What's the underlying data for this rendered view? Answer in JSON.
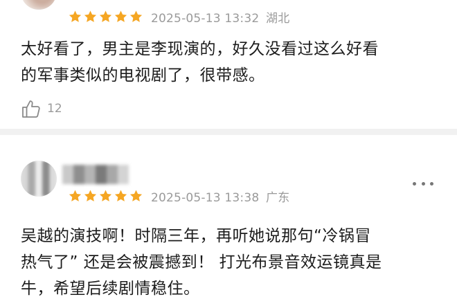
{
  "reviews": [
    {
      "rating": 5,
      "date": "2025-05-13 13:32",
      "region": "湖北",
      "content": "太好看了，男主是李现演的，好久没看过这么好看\n的军事类似的电视剧了，很带感。",
      "likes": "12"
    },
    {
      "rating": 5,
      "date": "2025-05-13 13:38",
      "region": "广东",
      "content": "吴越的演技啊！时隔三年，再听她说那句“冷锅冒\n热气了” 还是会被震撼到！ 打光布景音效运镜真是\n牛，希望后续剧情稳住。"
    }
  ],
  "colors": {
    "star": "#f5a623",
    "meta_text": "#9a9a9a",
    "body_text": "#1c1c1c",
    "divider": "#f1f1f1"
  },
  "icons": {
    "rating": "star-icon",
    "like": "thumbs-up-icon",
    "more": "more-dots-icon"
  }
}
